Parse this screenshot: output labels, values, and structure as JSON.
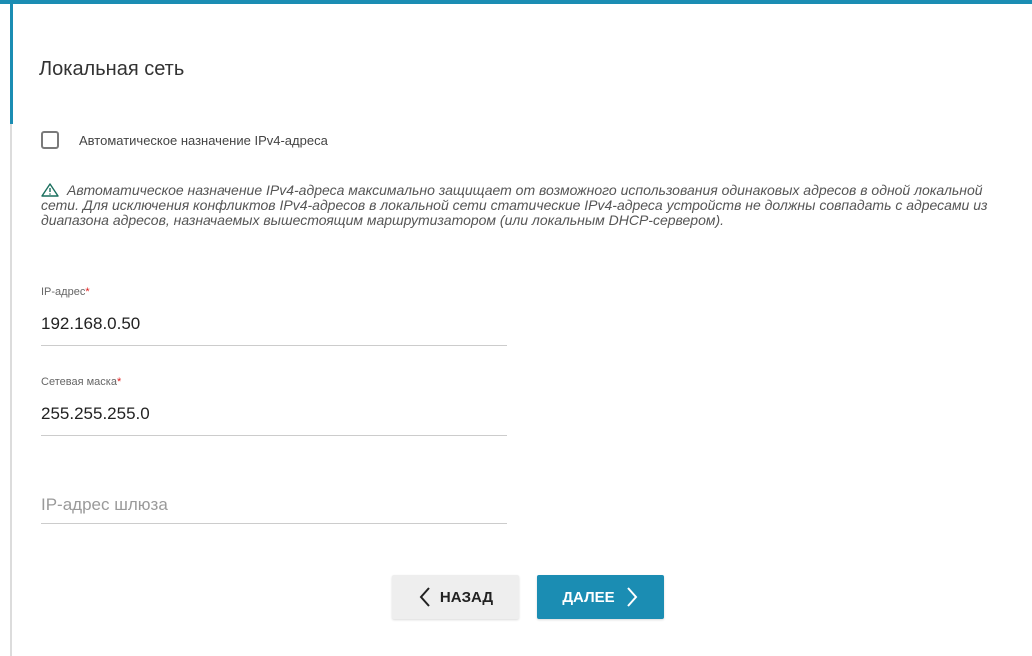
{
  "page": {
    "title": "Локальная сеть"
  },
  "auto_ipv4": {
    "checked": false,
    "label": "Автоматическое назначение IPv4-адреса"
  },
  "warning": {
    "icon": "warning-triangle-icon",
    "text": "Автоматическое назначение IPv4-адреса максимально защищает от возможного использования одинаковых адресов в одной локальной сети. Для исключения конфликтов IPv4-адресов в локальной сети статические IPv4-адреса устройств не должны совпадать с адресами из диапазона адресов, назначаемых вышестоящим маршрутизатором (или локальным DHCP-сервером)."
  },
  "fields": {
    "ip": {
      "label": "IP-адрес",
      "required_mark": "*",
      "value": "192.168.0.50"
    },
    "mask": {
      "label": "Сетевая маска",
      "required_mark": "*",
      "value": "255.255.255.0"
    },
    "gateway": {
      "placeholder": "IP-адрес шлюза",
      "value": ""
    }
  },
  "buttons": {
    "back": {
      "label": "НАЗАД",
      "icon": "chevron-left-icon"
    },
    "next": {
      "label": "ДАЛЕЕ",
      "icon": "chevron-right-icon"
    }
  },
  "colors": {
    "accent": "#1b8db3",
    "required": "#e02020"
  }
}
